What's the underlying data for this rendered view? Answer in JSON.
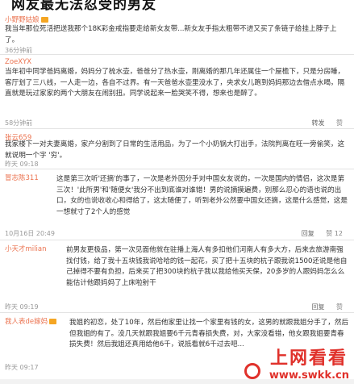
{
  "header": {
    "title": "网友最无法忍受的男友"
  },
  "comments": [
    {
      "user": "小野野姑娘",
      "text": "我当年那位死活把送我那个18K彩金戒指要走给新女友带...新女友手指太粗带不进又买了条链子给挂上脖子上了。",
      "time": "36分钟前",
      "actions": []
    },
    {
      "user": "ZoeXYX",
      "text": "当年初中同学爸妈离婚，妈妈分了梳水壶，爸爸分了热水壶，刚离婚的那几年还属住一个屋檐下，只是分房睡，客厅划了三八线，一人走一边，各自不过界。有一天爸爸水壶里没水了，央求女儿跑到妈妈那边去借点水喝，隔直就是玩过家家的两个大朋友在闹别扭。同学说起来一脸哭笑不得，想来也是醉了。",
      "time": "58分钟前",
      "actions": [
        "转发",
        "赞"
      ]
    },
    {
      "user": "张云659",
      "text": "我家楼下一对夫妻离婚，家产分割到了日常的生活用品，为了一个小奶锅大打出手，法院判离在旺一旁偷笑，这就说明一个字 '穷'。",
      "time": "昨天 09:18",
      "actions": []
    },
    {
      "user": "冒志陈311",
      "text": "这是第三次听'还摘'的事了，一次是老外因分手对中国女友说的，一次是国内的情侣，这次是第三次！'此所男'和'随便女'我分不出到底谁对谁错！男的说摘摸遍费，别那么忍心的语也说的出口，女的也说收收心和得给了，这太随便了，听到老外公然要中国女还摘，这是什么感觉，这是一想就寸了2个人的感觉",
      "time": "10月16日 20:49",
      "actions": [
        "回复",
        "赞 12"
      ]
    },
    {
      "user": "小天才milian",
      "text": "前男友更极品，第一次见面他就在驻播上海人有多扣他们河南人有多大方，后来去旅游南强找付钱，给了我十五块钱我说哈哈的钱一起花，买了把十五块的杭子跟我说1500还说是他自己掉得不要有负担，后来买了把300块的杭子我以我给他买天保，20多岁的人跟妈妈怎么么能估计他跟妈妈了上床啦射干",
      "time": "昨天 09:19",
      "actions": [
        "回复",
        "赞"
      ]
    },
    {
      "user": "我人表de嫁妈",
      "text": "我姐的初恋，处了10年，然后他家里让找一个家里有钱的女，这男的就跟我姐分手了，然后但我姐的有了。没几天就跟我姐要6千元青春损失费，对，大家没看错，他女跟我姐要青春损失费！然后我姐还真用给他6千，说抵看就6千过去吧...",
      "time": "昨天 09:17",
      "actions": []
    }
  ],
  "watermark": {
    "site": "上网看看",
    "url": "www.swkk.cn"
  }
}
